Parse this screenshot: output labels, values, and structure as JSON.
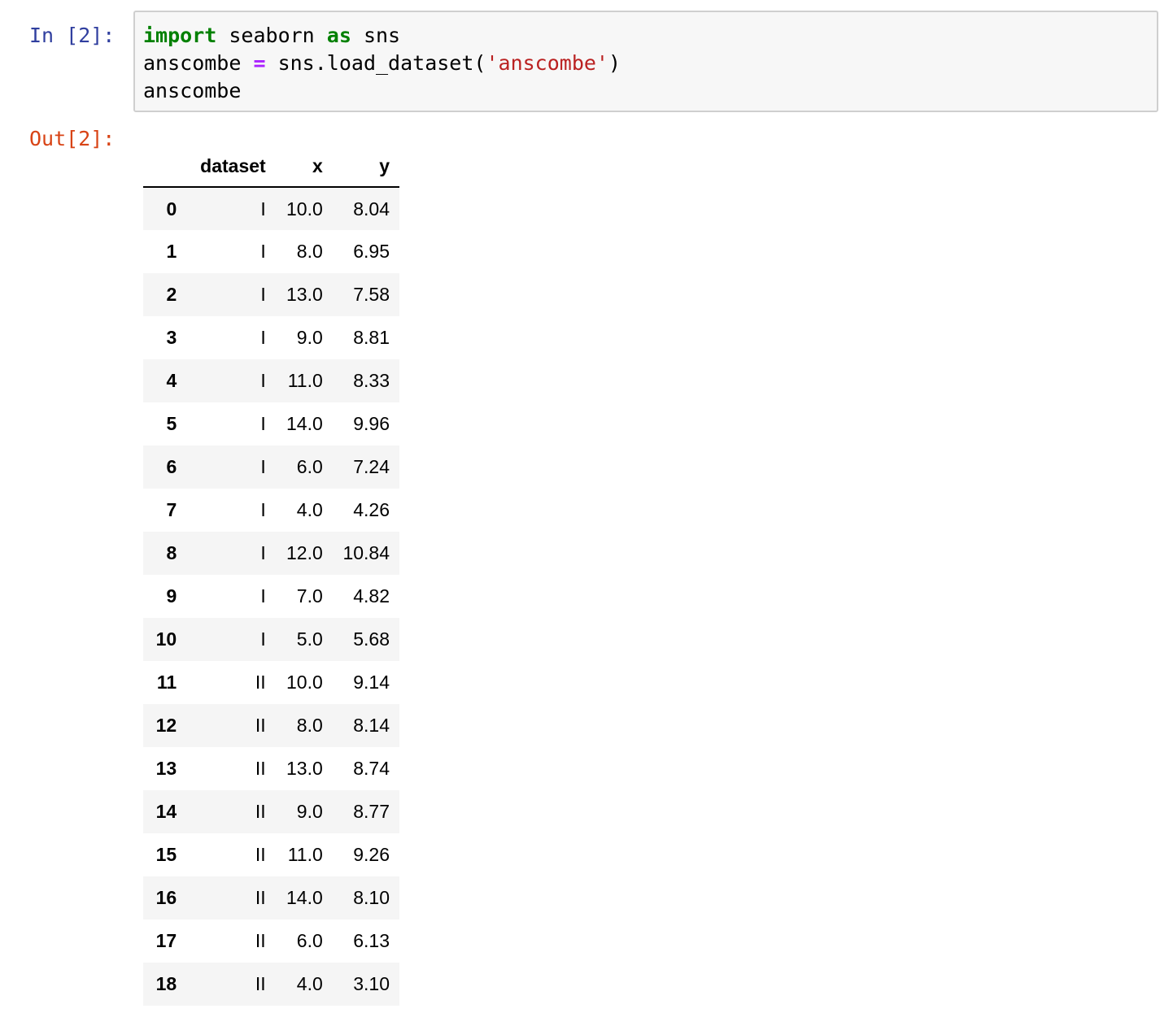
{
  "input_cell": {
    "prompt": "In [2]:",
    "code": {
      "line1": {
        "kw_import": "import",
        "module": " seaborn ",
        "kw_as": "as",
        "alias": " sns"
      },
      "line2": {
        "var": "anscombe ",
        "op": "=",
        "call": " sns.load_dataset(",
        "arg": "'anscombe'",
        "close": ")"
      },
      "line3": "anscombe"
    }
  },
  "output_cell": {
    "prompt": "Out[2]:",
    "table": {
      "columns": [
        "",
        "dataset",
        "x",
        "y"
      ],
      "rows": [
        {
          "index": "0",
          "dataset": "I",
          "x": "10.0",
          "y": "8.04"
        },
        {
          "index": "1",
          "dataset": "I",
          "x": "8.0",
          "y": "6.95"
        },
        {
          "index": "2",
          "dataset": "I",
          "x": "13.0",
          "y": "7.58"
        },
        {
          "index": "3",
          "dataset": "I",
          "x": "9.0",
          "y": "8.81"
        },
        {
          "index": "4",
          "dataset": "I",
          "x": "11.0",
          "y": "8.33"
        },
        {
          "index": "5",
          "dataset": "I",
          "x": "14.0",
          "y": "9.96"
        },
        {
          "index": "6",
          "dataset": "I",
          "x": "6.0",
          "y": "7.24"
        },
        {
          "index": "7",
          "dataset": "I",
          "x": "4.0",
          "y": "4.26"
        },
        {
          "index": "8",
          "dataset": "I",
          "x": "12.0",
          "y": "10.84"
        },
        {
          "index": "9",
          "dataset": "I",
          "x": "7.0",
          "y": "4.82"
        },
        {
          "index": "10",
          "dataset": "I",
          "x": "5.0",
          "y": "5.68"
        },
        {
          "index": "11",
          "dataset": "II",
          "x": "10.0",
          "y": "9.14"
        },
        {
          "index": "12",
          "dataset": "II",
          "x": "8.0",
          "y": "8.14"
        },
        {
          "index": "13",
          "dataset": "II",
          "x": "13.0",
          "y": "8.74"
        },
        {
          "index": "14",
          "dataset": "II",
          "x": "9.0",
          "y": "8.77"
        },
        {
          "index": "15",
          "dataset": "II",
          "x": "11.0",
          "y": "9.26"
        },
        {
          "index": "16",
          "dataset": "II",
          "x": "14.0",
          "y": "8.10"
        },
        {
          "index": "17",
          "dataset": "II",
          "x": "6.0",
          "y": "6.13"
        },
        {
          "index": "18",
          "dataset": "II",
          "x": "4.0",
          "y": "3.10"
        }
      ]
    }
  },
  "colors": {
    "in_prompt": "#303f9f",
    "out_prompt": "#d84315",
    "keyword": "#008000",
    "operator": "#aa22ff",
    "string": "#ba2121",
    "cell_background": "#f7f7f7",
    "cell_border": "#cfcfcf"
  }
}
